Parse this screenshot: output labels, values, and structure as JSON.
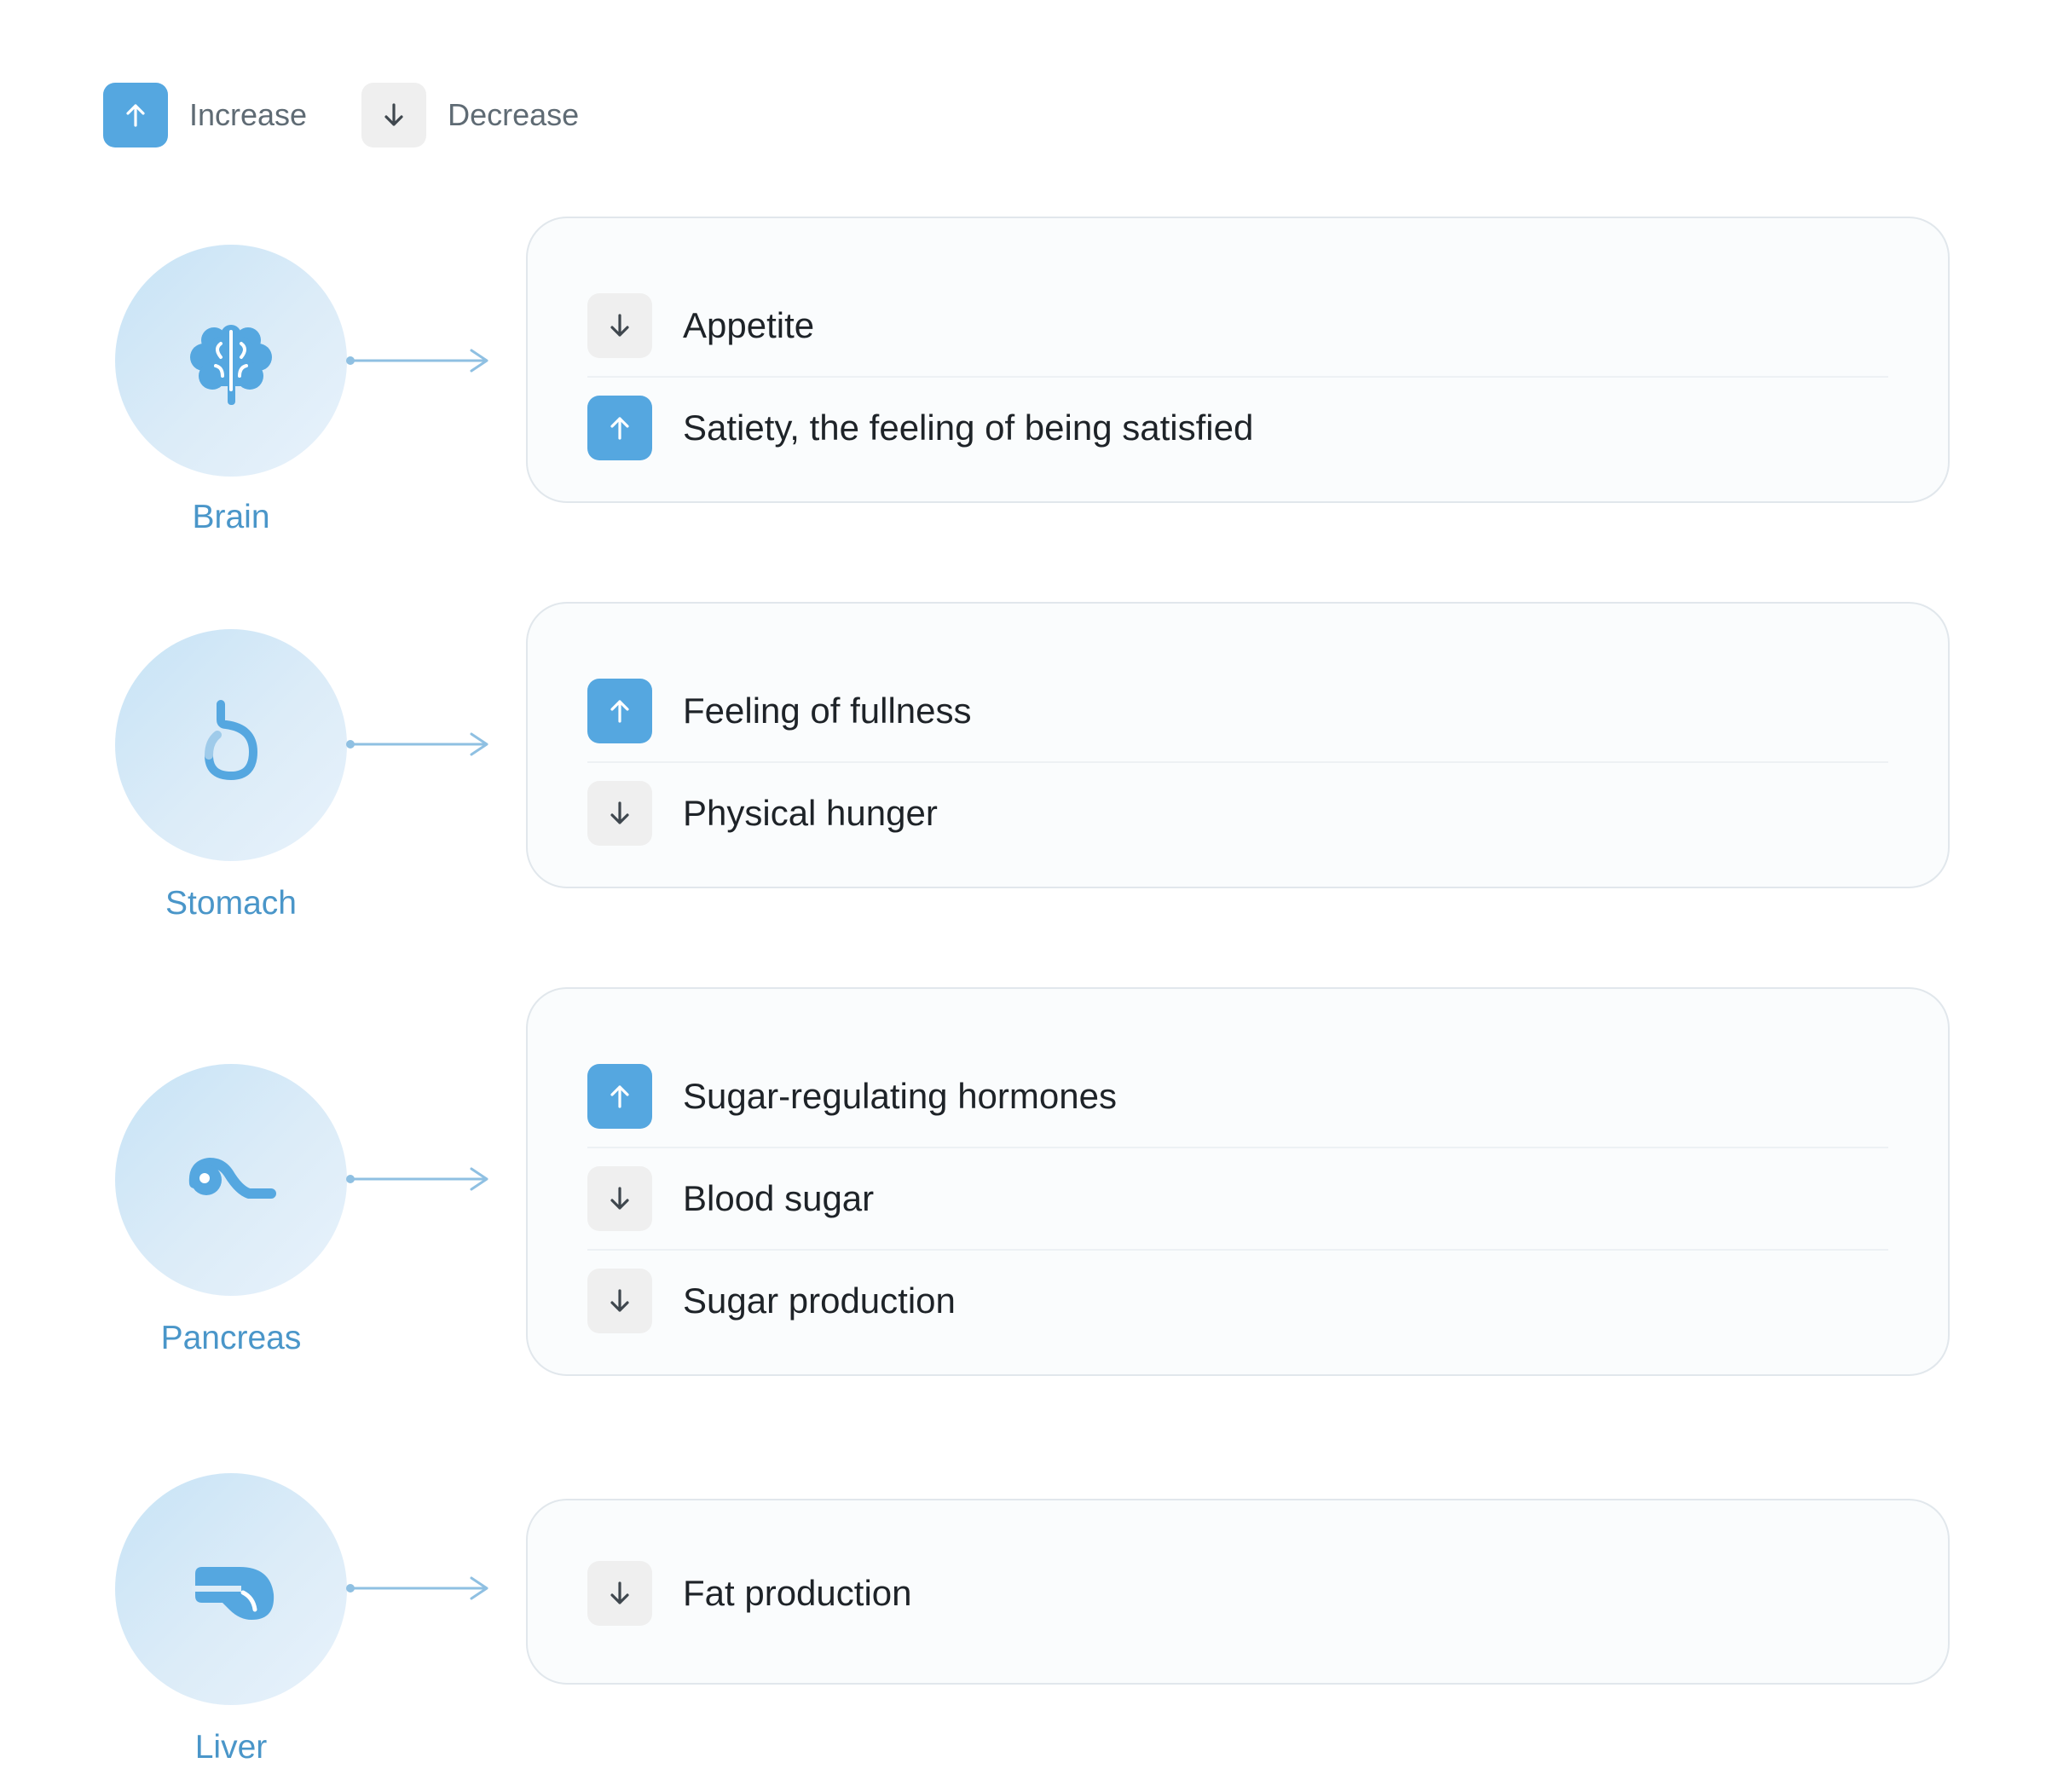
{
  "legend": {
    "increase_label": "Increase",
    "decrease_label": "Decrease"
  },
  "colors": {
    "increase": "#55a7e0",
    "decrease": "#efefef",
    "organ_label": "#4a96c9",
    "connector": "#8fc0e2"
  },
  "organs": [
    {
      "name": "Brain",
      "icon": "brain-icon",
      "effects": [
        {
          "direction": "decrease",
          "text": "Appetite"
        },
        {
          "direction": "increase",
          "text": "Satiety, the feeling of being satisfied"
        }
      ]
    },
    {
      "name": "Stomach",
      "icon": "stomach-icon",
      "effects": [
        {
          "direction": "increase",
          "text": "Feeling of fullness"
        },
        {
          "direction": "decrease",
          "text": "Physical hunger"
        }
      ]
    },
    {
      "name": "Pancreas",
      "icon": "pancreas-icon",
      "effects": [
        {
          "direction": "increase",
          "text": "Sugar-regulating hormones"
        },
        {
          "direction": "decrease",
          "text": "Blood sugar"
        },
        {
          "direction": "decrease",
          "text": "Sugar production"
        }
      ]
    },
    {
      "name": "Liver",
      "icon": "liver-icon",
      "effects": [
        {
          "direction": "decrease",
          "text": "Fat production"
        }
      ]
    }
  ]
}
